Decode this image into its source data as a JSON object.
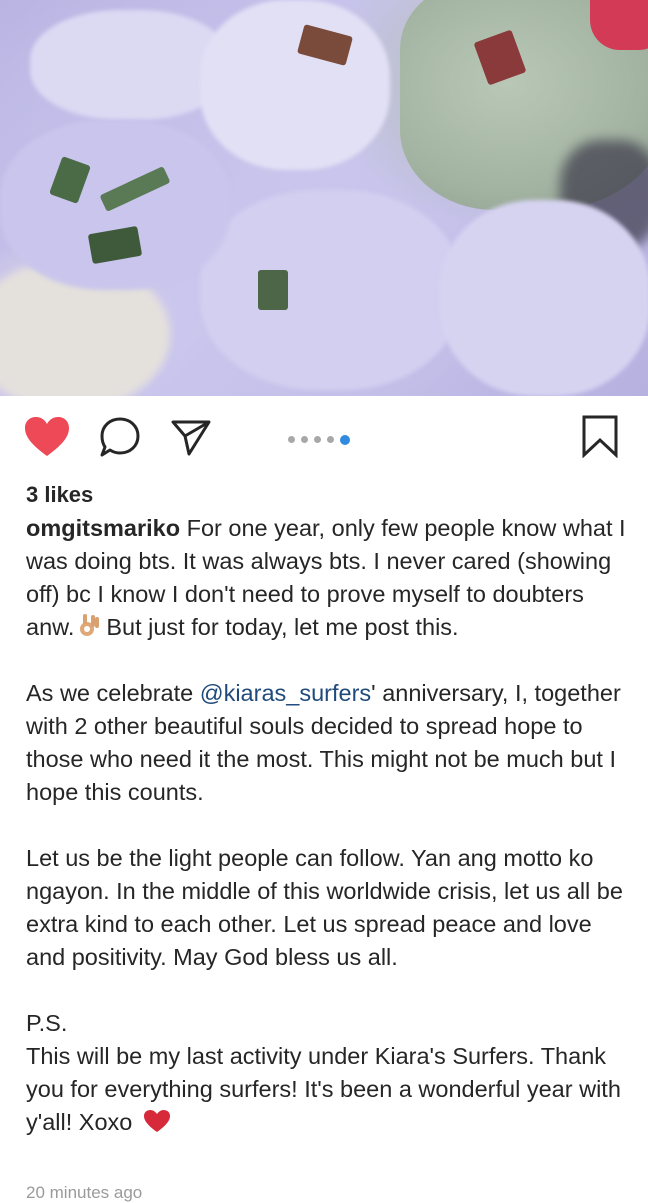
{
  "post": {
    "image_alt": "",
    "likes": "3 likes",
    "username": "omgitsmariko",
    "caption": {
      "p1_text": "For one year, only few people know what I was doing bts. It was always bts. I never cared (showing off) bc I know I don't need to prove myself to doubters anw.",
      "p1_tail": "But just for today, let me post this.",
      "p2_before": "As we celebrate ",
      "p2_mention": "@kiaras_surfers",
      "p2_after": "' anniversary, I, together with 2 other beautiful souls decided to spread hope to those who need it the most. This might not be much but I hope this counts.",
      "p3": "Let us be the light people can follow. Yan ang motto ko ngayon. In the middle of this worldwide crisis, let us all be extra kind to each other. Let us spread peace and love and positivity. May God bless us all.",
      "p4_line1": "P.S.",
      "p4_line2": "This will be my last activity under Kiara's Surfers. Thank you for everything surfers! It's been a wonderful year with y'all! Xoxo"
    },
    "timestamp": "20 minutes ago"
  },
  "actions": {
    "like_icon": "heart-filled-icon",
    "comment_icon": "comment-bubble-icon",
    "share_icon": "paper-plane-icon",
    "save_icon": "bookmark-icon",
    "carousel_count": 5,
    "carousel_active": 5
  },
  "colors": {
    "heart": "#ed4956",
    "active_dot": "#2f8ae0",
    "mention": "#1f4a7a",
    "text": "#262626"
  }
}
